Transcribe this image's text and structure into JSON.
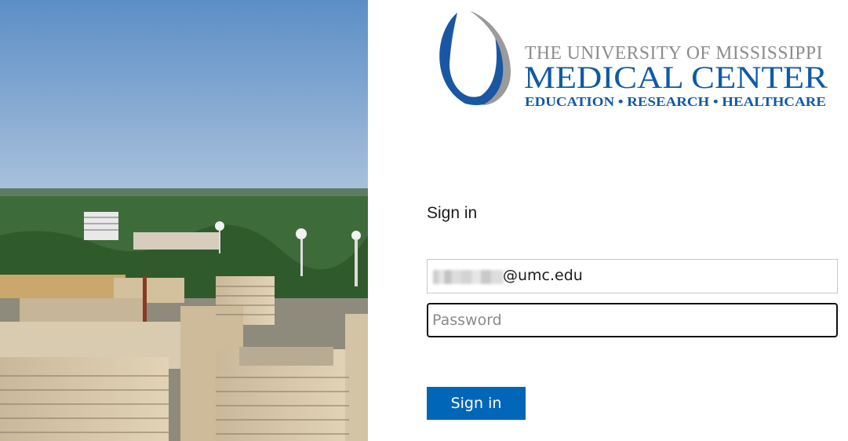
{
  "logo": {
    "line1": "THE UNIVERSITY OF MISSISSIPPI",
    "line2": "MEDICAL CENTER",
    "line3": "EDUCATION • RESEARCH • HEALTHCARE"
  },
  "signin": {
    "heading": "Sign in",
    "email_value_visible": "@umc.edu",
    "password_placeholder": "Password",
    "button_label": "Sign in"
  },
  "colors": {
    "brand_blue": "#0f5aa6",
    "logo_gray": "#8c8c8c",
    "button_blue": "#0067b8",
    "sky": "#6f9ccd"
  },
  "icons": [
    "umc-logo-mark"
  ]
}
